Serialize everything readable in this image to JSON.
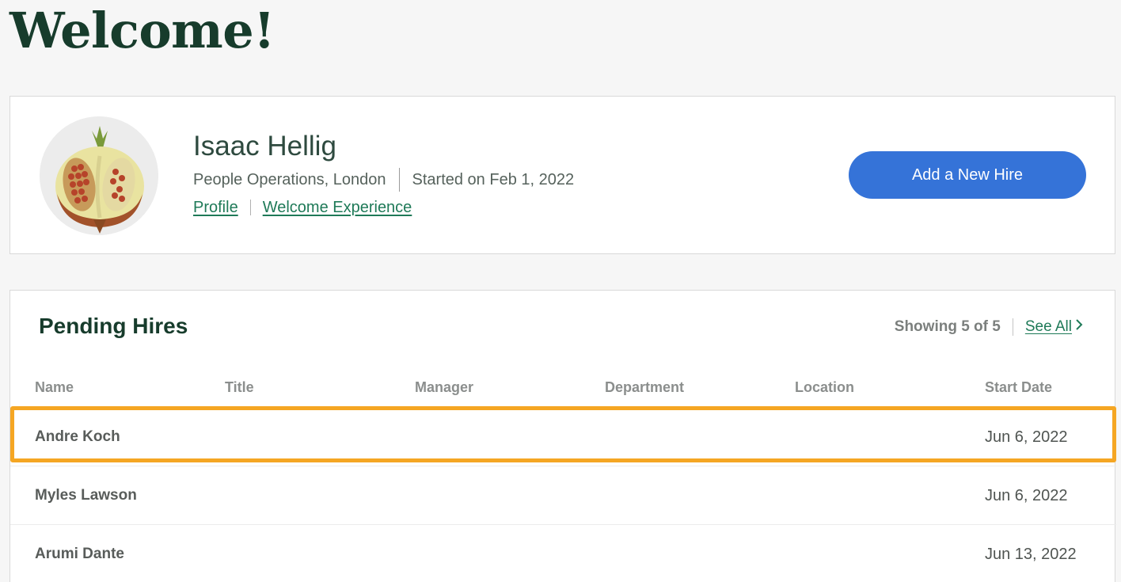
{
  "page": {
    "title": "Welcome!"
  },
  "profile": {
    "name": "Isaac Hellig",
    "department_location": "People Operations, London",
    "start_text": "Started on Feb 1, 2022",
    "links": {
      "profile": "Profile",
      "welcome_experience": "Welcome Experience"
    },
    "avatar_icon": "pomegranate-icon",
    "add_hire_label": "Add a New Hire",
    "add_hire_color": "#3573d8"
  },
  "pending": {
    "title": "Pending Hires",
    "showing": "Showing 5 of 5",
    "see_all": "See All",
    "columns": {
      "name": "Name",
      "title": "Title",
      "manager": "Manager",
      "department": "Department",
      "location": "Location",
      "start_date": "Start Date"
    },
    "rows": [
      {
        "name": "Andre Koch",
        "start_date": "Jun 6, 2022",
        "highlighted": true
      },
      {
        "name": "Myles Lawson",
        "start_date": "Jun 6, 2022"
      },
      {
        "name": "Arumi Dante",
        "start_date": "Jun 13, 2022"
      }
    ]
  },
  "colors": {
    "link": "#1f7a58",
    "highlight": "#f5a623",
    "heading": "#173c2c"
  }
}
